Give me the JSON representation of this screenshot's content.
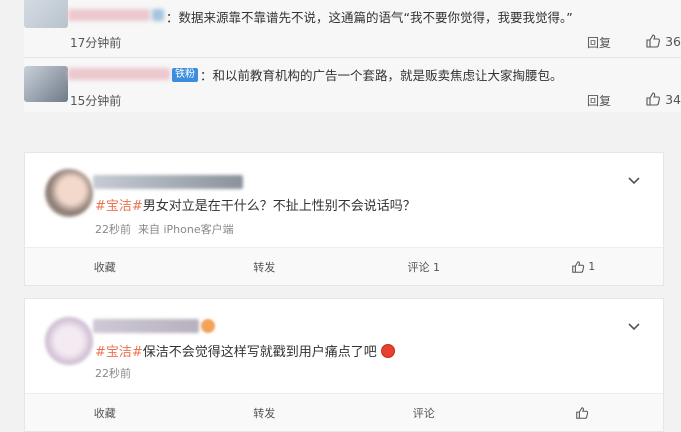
{
  "replies": [
    {
      "text": "：数据来源靠不靠谱先不说，这通篇的语气“我不要你觉得，我要我觉得。”",
      "time": "17分钟前",
      "reply_label": "回复",
      "like_count": "36"
    },
    {
      "badge": "铁粉",
      "text": "：和以前教育机构的广告一个套路，就是贩卖焦虑让大家掏腰包。",
      "time": "15分钟前",
      "reply_label": "回复",
      "like_count": "34"
    }
  ],
  "posts": [
    {
      "tag": "#宝洁#",
      "text": "男女对立是在干什么？不扯上性别不会说话吗？",
      "time": "22秒前",
      "source": "来自 iPhone客户端",
      "actions": {
        "collect": "收藏",
        "repost": "转发",
        "comment": "评论 1",
        "like": "1"
      }
    },
    {
      "tag": "#宝洁#",
      "text": "保洁不会觉得这样写就戳到用户痛点了吧",
      "time": "22秒前",
      "actions": {
        "collect": "收藏",
        "repost": "转发",
        "comment": "评论",
        "like": ""
      }
    }
  ],
  "colors": {
    "tag": "#eb7350",
    "badge": "#3b8de0"
  }
}
